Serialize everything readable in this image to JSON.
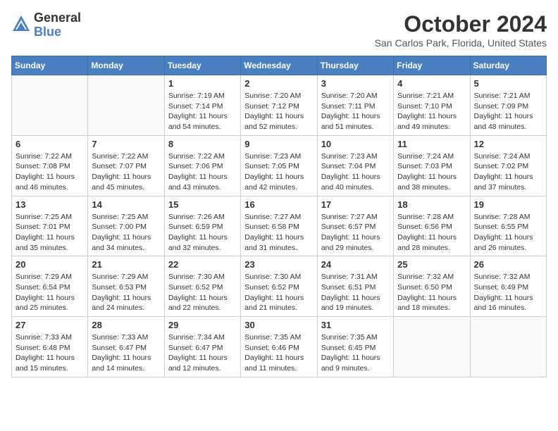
{
  "logo": {
    "general": "General",
    "blue": "Blue"
  },
  "title": "October 2024",
  "subtitle": "San Carlos Park, Florida, United States",
  "days_of_week": [
    "Sunday",
    "Monday",
    "Tuesday",
    "Wednesday",
    "Thursday",
    "Friday",
    "Saturday"
  ],
  "weeks": [
    [
      {
        "day": "",
        "info": ""
      },
      {
        "day": "",
        "info": ""
      },
      {
        "day": "1",
        "info": "Sunrise: 7:19 AM\nSunset: 7:14 PM\nDaylight: 11 hours and 54 minutes."
      },
      {
        "day": "2",
        "info": "Sunrise: 7:20 AM\nSunset: 7:12 PM\nDaylight: 11 hours and 52 minutes."
      },
      {
        "day": "3",
        "info": "Sunrise: 7:20 AM\nSunset: 7:11 PM\nDaylight: 11 hours and 51 minutes."
      },
      {
        "day": "4",
        "info": "Sunrise: 7:21 AM\nSunset: 7:10 PM\nDaylight: 11 hours and 49 minutes."
      },
      {
        "day": "5",
        "info": "Sunrise: 7:21 AM\nSunset: 7:09 PM\nDaylight: 11 hours and 48 minutes."
      }
    ],
    [
      {
        "day": "6",
        "info": "Sunrise: 7:22 AM\nSunset: 7:08 PM\nDaylight: 11 hours and 46 minutes."
      },
      {
        "day": "7",
        "info": "Sunrise: 7:22 AM\nSunset: 7:07 PM\nDaylight: 11 hours and 45 minutes."
      },
      {
        "day": "8",
        "info": "Sunrise: 7:22 AM\nSunset: 7:06 PM\nDaylight: 11 hours and 43 minutes."
      },
      {
        "day": "9",
        "info": "Sunrise: 7:23 AM\nSunset: 7:05 PM\nDaylight: 11 hours and 42 minutes."
      },
      {
        "day": "10",
        "info": "Sunrise: 7:23 AM\nSunset: 7:04 PM\nDaylight: 11 hours and 40 minutes."
      },
      {
        "day": "11",
        "info": "Sunrise: 7:24 AM\nSunset: 7:03 PM\nDaylight: 11 hours and 38 minutes."
      },
      {
        "day": "12",
        "info": "Sunrise: 7:24 AM\nSunset: 7:02 PM\nDaylight: 11 hours and 37 minutes."
      }
    ],
    [
      {
        "day": "13",
        "info": "Sunrise: 7:25 AM\nSunset: 7:01 PM\nDaylight: 11 hours and 35 minutes."
      },
      {
        "day": "14",
        "info": "Sunrise: 7:25 AM\nSunset: 7:00 PM\nDaylight: 11 hours and 34 minutes."
      },
      {
        "day": "15",
        "info": "Sunrise: 7:26 AM\nSunset: 6:59 PM\nDaylight: 11 hours and 32 minutes."
      },
      {
        "day": "16",
        "info": "Sunrise: 7:27 AM\nSunset: 6:58 PM\nDaylight: 11 hours and 31 minutes."
      },
      {
        "day": "17",
        "info": "Sunrise: 7:27 AM\nSunset: 6:57 PM\nDaylight: 11 hours and 29 minutes."
      },
      {
        "day": "18",
        "info": "Sunrise: 7:28 AM\nSunset: 6:56 PM\nDaylight: 11 hours and 28 minutes."
      },
      {
        "day": "19",
        "info": "Sunrise: 7:28 AM\nSunset: 6:55 PM\nDaylight: 11 hours and 26 minutes."
      }
    ],
    [
      {
        "day": "20",
        "info": "Sunrise: 7:29 AM\nSunset: 6:54 PM\nDaylight: 11 hours and 25 minutes."
      },
      {
        "day": "21",
        "info": "Sunrise: 7:29 AM\nSunset: 6:53 PM\nDaylight: 11 hours and 24 minutes."
      },
      {
        "day": "22",
        "info": "Sunrise: 7:30 AM\nSunset: 6:52 PM\nDaylight: 11 hours and 22 minutes."
      },
      {
        "day": "23",
        "info": "Sunrise: 7:30 AM\nSunset: 6:52 PM\nDaylight: 11 hours and 21 minutes."
      },
      {
        "day": "24",
        "info": "Sunrise: 7:31 AM\nSunset: 6:51 PM\nDaylight: 11 hours and 19 minutes."
      },
      {
        "day": "25",
        "info": "Sunrise: 7:32 AM\nSunset: 6:50 PM\nDaylight: 11 hours and 18 minutes."
      },
      {
        "day": "26",
        "info": "Sunrise: 7:32 AM\nSunset: 6:49 PM\nDaylight: 11 hours and 16 minutes."
      }
    ],
    [
      {
        "day": "27",
        "info": "Sunrise: 7:33 AM\nSunset: 6:48 PM\nDaylight: 11 hours and 15 minutes."
      },
      {
        "day": "28",
        "info": "Sunrise: 7:33 AM\nSunset: 6:47 PM\nDaylight: 11 hours and 14 minutes."
      },
      {
        "day": "29",
        "info": "Sunrise: 7:34 AM\nSunset: 6:47 PM\nDaylight: 11 hours and 12 minutes."
      },
      {
        "day": "30",
        "info": "Sunrise: 7:35 AM\nSunset: 6:46 PM\nDaylight: 11 hours and 11 minutes."
      },
      {
        "day": "31",
        "info": "Sunrise: 7:35 AM\nSunset: 6:45 PM\nDaylight: 11 hours and 9 minutes."
      },
      {
        "day": "",
        "info": ""
      },
      {
        "day": "",
        "info": ""
      }
    ]
  ]
}
